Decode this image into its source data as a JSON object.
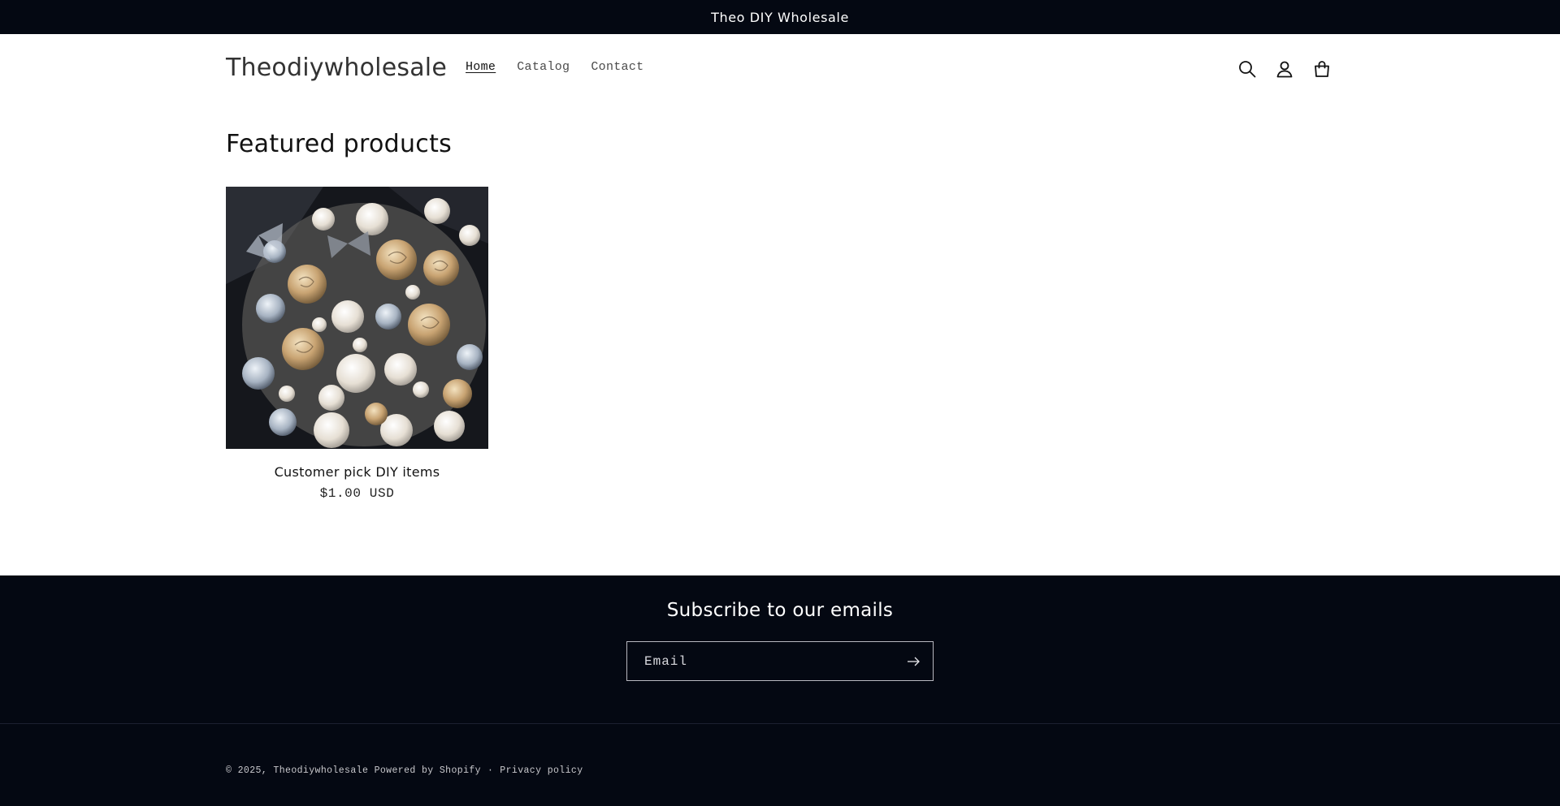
{
  "announcement": {
    "text": "Theo DIY Wholesale"
  },
  "header": {
    "logo": "Theodiywholesale",
    "nav": [
      {
        "label": "Home",
        "active": true
      },
      {
        "label": "Catalog",
        "active": false
      },
      {
        "label": "Contact",
        "active": false
      }
    ],
    "icons": [
      "search-icon",
      "account-icon",
      "cart-icon"
    ]
  },
  "featured": {
    "title": "Featured products",
    "products": [
      {
        "title": "Customer pick DIY items",
        "price": "$1.00 USD"
      }
    ]
  },
  "footer": {
    "subscribe_title": "Subscribe to our emails",
    "email_placeholder": "Email",
    "copyright_prefix": "© 2025,",
    "copyright_store": "Theodiywholesale",
    "powered_by": "Powered by Shopify",
    "separator": "·",
    "privacy": "Privacy policy"
  },
  "colors": {
    "announcement_bg": "#040812",
    "footer_bg": "#040812",
    "text": "#121212"
  }
}
